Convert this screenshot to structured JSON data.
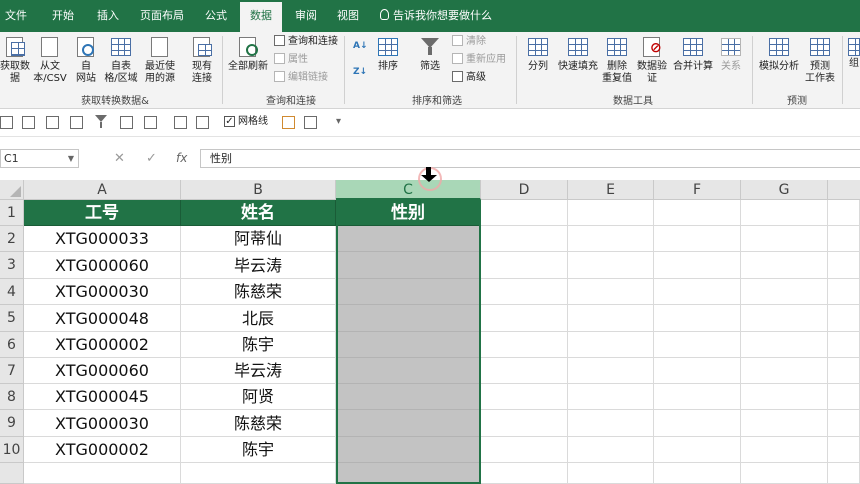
{
  "ribbon_tabs": [
    {
      "label": "文件"
    },
    {
      "label": "开始"
    },
    {
      "label": "插入"
    },
    {
      "label": "页面布局"
    },
    {
      "label": "公式"
    },
    {
      "label": "数据",
      "active": true
    },
    {
      "label": "审阅"
    },
    {
      "label": "视图"
    }
  ],
  "tell_me": "告诉我你想要做什么",
  "groups": {
    "get_transform": {
      "label": "获取转换数据&",
      "buttons": [
        "获取数\n据",
        "从文\n本/CSV",
        "自\n网站",
        "自表\n格/区域",
        "最近使\n用的源",
        "现有\n连接"
      ]
    },
    "queries": {
      "label": "查询和连接",
      "refresh_all": "全部刷新",
      "small": [
        "查询和连接",
        "属性",
        "编辑链接"
      ]
    },
    "sort_filter": {
      "label": "排序和筛选",
      "sort": "排序",
      "filter": "筛选",
      "small": [
        "清除",
        "重新应用",
        "高级"
      ]
    },
    "data_tools": {
      "label": "数据工具",
      "buttons": [
        "分列",
        "快速填充",
        "删除\n重复值",
        "数据验\n证",
        "合并计算",
        "关系"
      ]
    },
    "forecast": {
      "label": "预测",
      "buttons": [
        "模拟分析",
        "预测\n工作表"
      ]
    },
    "outline_partial": "组"
  },
  "qat": {
    "gridlines_label": "网格线"
  },
  "formula_bar": {
    "name_box": "C1",
    "formula": "性别",
    "fx": "fx"
  },
  "columns": [
    "A",
    "B",
    "C",
    "D",
    "E",
    "F",
    "G"
  ],
  "rows": [
    "1",
    "2",
    "3",
    "4",
    "5",
    "6",
    "7",
    "8",
    "9",
    "10"
  ],
  "table": {
    "headers": [
      "工号",
      "姓名",
      "性别"
    ],
    "rows": [
      [
        "XTG000033",
        "阿蒂仙"
      ],
      [
        "XTG000060",
        "毕云涛"
      ],
      [
        "XTG000030",
        "陈慈荣"
      ],
      [
        "XTG000048",
        "北辰"
      ],
      [
        "XTG000002",
        "陈宇"
      ],
      [
        "XTG000060",
        "毕云涛"
      ],
      [
        "XTG000045",
        "阿贤"
      ],
      [
        "XTG000030",
        "陈慈荣"
      ],
      [
        "XTG000002",
        "陈宇"
      ]
    ]
  },
  "colors": {
    "brand": "#217346",
    "selected_column_fill": "#c3c3c3"
  }
}
